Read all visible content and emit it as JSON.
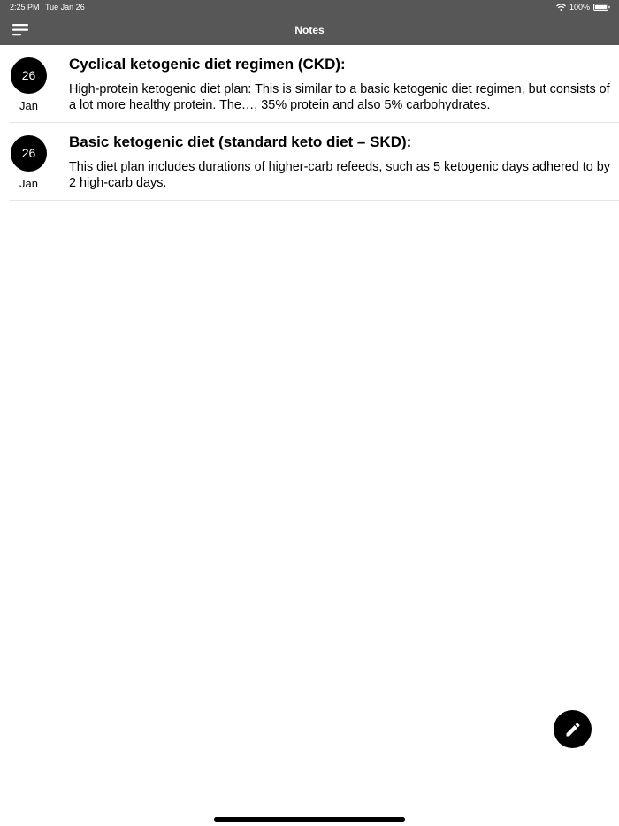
{
  "status_bar": {
    "time": "2:25 PM",
    "date": "Tue Jan 26",
    "battery": "100%"
  },
  "nav": {
    "title": "Notes",
    "menu_icon": "menu-icon"
  },
  "notes": [
    {
      "day": "26",
      "month": "Jan",
      "title": "Cyclical ketogenic diet regimen (CKD):",
      "body": "High-protein ketogenic diet plan: This is similar to a basic ketogenic diet regimen, but consists of a lot more healthy protein. The…, 35% protein and also 5% carbohydrates."
    },
    {
      "day": "26",
      "month": "Jan",
      "title": "Basic ketogenic diet (standard keto diet – SKD):",
      "body": "This diet plan includes durations of higher-carb refeeds, such as 5 ketogenic days adhered to by 2 high-carb days."
    }
  ],
  "fab": {
    "icon": "pencil-icon"
  },
  "colors": {
    "header_bg": "#575757",
    "badge_bg": "#000000",
    "fab_bg": "#000000",
    "divider": "#e4e4e4"
  }
}
